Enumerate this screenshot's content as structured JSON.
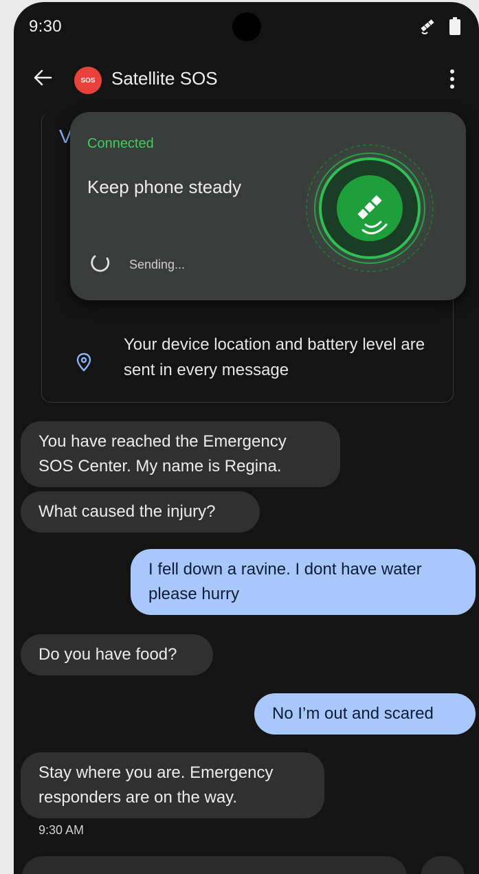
{
  "status_bar": {
    "time": "9:30"
  },
  "app_bar": {
    "badge": "SOS",
    "title": "Satellite SOS"
  },
  "info_card": {
    "peek_letter": "V",
    "location_text": "Your device location and battery level are sent in every message"
  },
  "popup": {
    "status": "Connected",
    "instruction": "Keep phone steady",
    "sending": "Sending..."
  },
  "messages": [
    {
      "from": "center",
      "text": "You have reached the Emergency SOS Center. My name is Regina."
    },
    {
      "from": "center",
      "text": "What caused the injury?"
    },
    {
      "from": "user",
      "text": "I fell down a ravine. I dont have water please hurry"
    },
    {
      "from": "center",
      "text": "Do you have food?"
    },
    {
      "from": "user",
      "text": "No I’m out and scared"
    },
    {
      "from": "center",
      "text": "Stay where you are. Emergency responders are on the way."
    }
  ],
  "last_timestamp": "9:30 AM",
  "colors": {
    "accent_green": "#3fcf5e",
    "sos_red": "#e8423b",
    "outgoing_bubble": "#a8c7fa"
  }
}
